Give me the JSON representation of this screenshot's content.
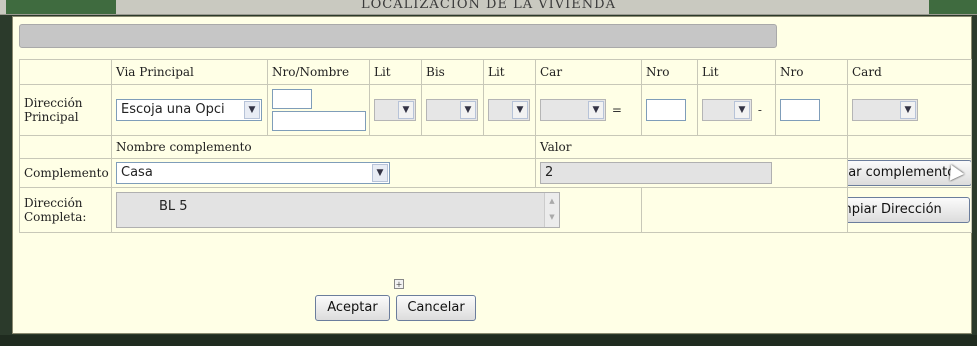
{
  "page": {
    "title": "LOCALIZACION DE LA VIVIENDA"
  },
  "headers": {
    "via_principal": "Via Principal",
    "nro_nombre": "Nro/Nombre",
    "lit1": "Lit",
    "bis": "Bis",
    "lit2": "Lit",
    "car": "Car",
    "nro1": "Nro",
    "lit3": "Lit",
    "nro2": "Nro",
    "card": "Card"
  },
  "direccion_principal": {
    "label": "Dirección Principal",
    "via_select": "Escoja una Opci",
    "eq_sign": "=",
    "dash_sign": "-"
  },
  "complemento": {
    "header_nombre": "Nombre complemento",
    "header_valor": "Valor",
    "label": "Complemento",
    "selected": "Casa",
    "valor": "2",
    "add_button": "Adicionar complemento"
  },
  "direccion_completa": {
    "label": "Dirección Completa:",
    "value": "BL 5",
    "clear_button": "Limpiar Dirección"
  },
  "actions": {
    "expand_glyph": "+",
    "ok_button": "Aceptar",
    "cancel_button": "Cancelar"
  }
}
